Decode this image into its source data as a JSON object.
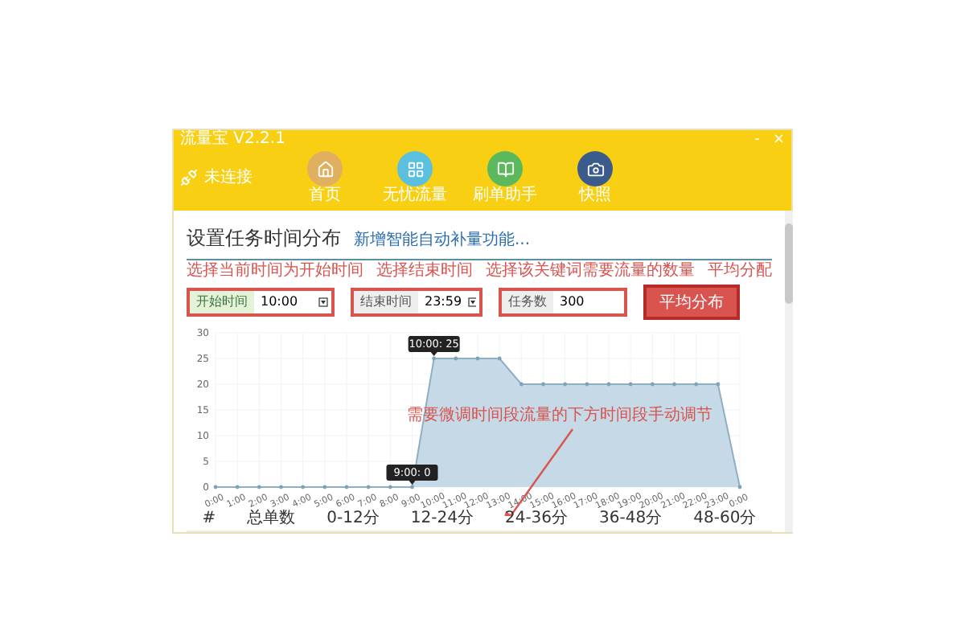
{
  "window": {
    "title": "流量宝 V2.2.1",
    "controls": [
      "-",
      "×"
    ]
  },
  "header": {
    "status": "未连接",
    "nav": [
      {
        "label": "首页",
        "color": "#e0b060"
      },
      {
        "label": "无忧流量",
        "color": "#5bc0de"
      },
      {
        "label": "刷单助手",
        "color": "#5cb85c"
      },
      {
        "label": "快照",
        "color": "#3b5b8c"
      }
    ]
  },
  "section": {
    "title": "设置任务时间分布",
    "link": "新增智能自动补量功能...",
    "notes": [
      "选择当前时间为开始时间",
      "选择结束时间",
      "选择该关键词需要流量的数量",
      "平均分配"
    ],
    "start": {
      "label": "开始时间",
      "value": "10:00"
    },
    "end": {
      "label": "结束时间",
      "value": "23:59"
    },
    "count": {
      "label": "任务数",
      "value": "300"
    },
    "button": "平均分布",
    "chart_note": "需要微调时间段流量的下方时间段手动调节",
    "chart_data": {
      "type": "area",
      "categories": [
        "0:00",
        "1:00",
        "2:00",
        "3:00",
        "4:00",
        "5:00",
        "6:00",
        "7:00",
        "8:00",
        "9:00",
        "10:00",
        "11:00",
        "12:00",
        "13:00",
        "14:00",
        "15:00",
        "16:00",
        "17:00",
        "18:00",
        "19:00",
        "20:00",
        "21:00",
        "22:00",
        "23:00",
        "0:00"
      ],
      "series": [
        {
          "color": "#c5d9e6",
          "values": [
            0,
            0,
            0,
            0,
            0,
            0,
            0,
            0,
            0,
            0,
            25,
            25,
            25,
            25,
            20,
            20,
            20,
            20,
            20,
            20,
            20,
            20,
            20,
            20,
            0
          ]
        }
      ],
      "ylim": [
        0,
        30
      ],
      "yticks": [
        0,
        5,
        10,
        15,
        20,
        25,
        30
      ],
      "grid": true,
      "annotations": [
        {
          "x": "10:00",
          "y": 25,
          "text": "10:00: 25"
        },
        {
          "x": "9:00",
          "y": 0,
          "text": "9:00: 0"
        }
      ]
    },
    "table_columns": [
      "#",
      "总单数",
      "0-12分",
      "12-24分",
      "24-36分",
      "36-48分",
      "48-60分"
    ]
  }
}
